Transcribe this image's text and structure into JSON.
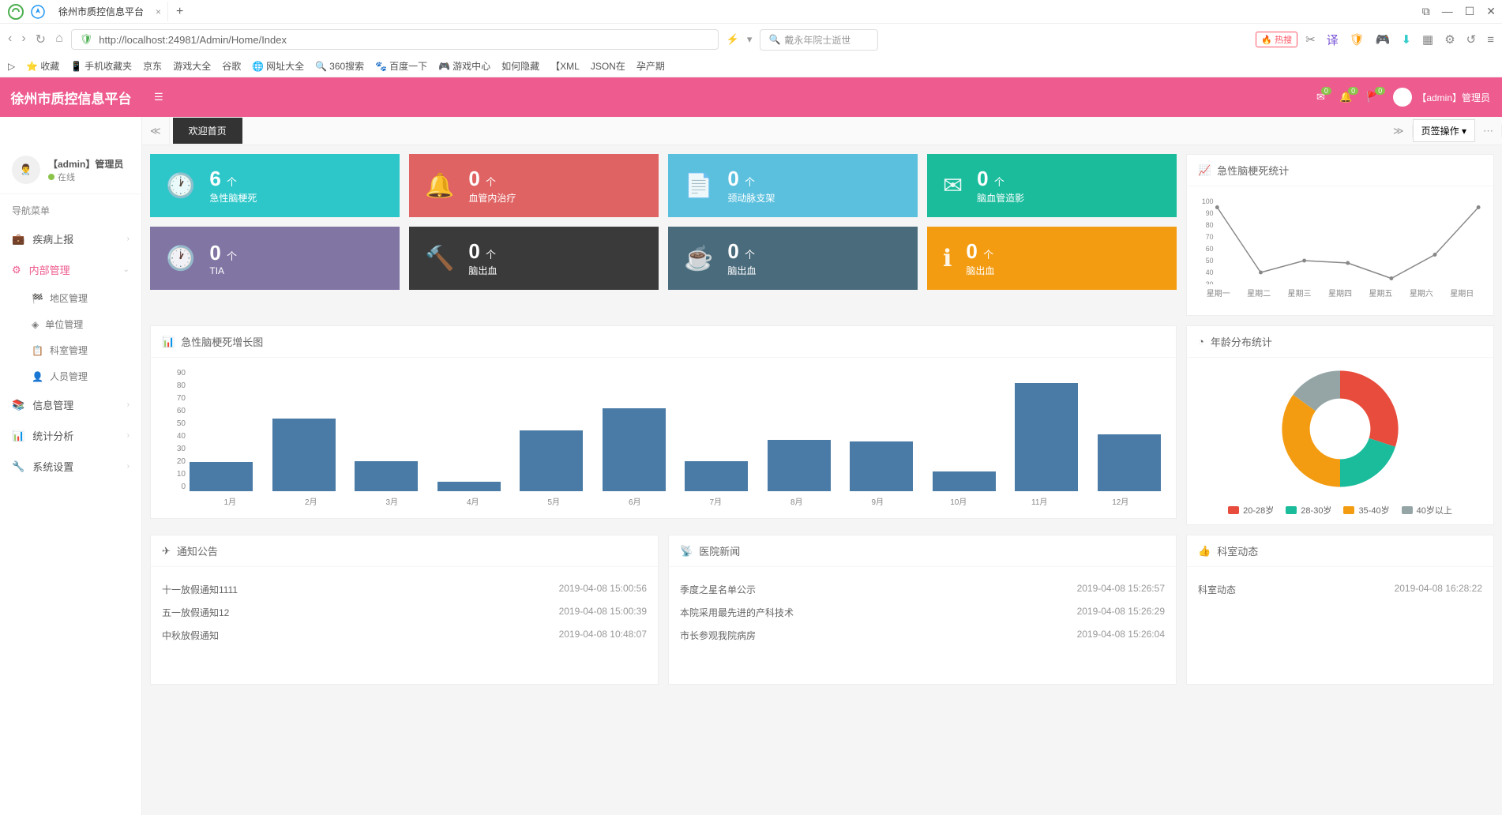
{
  "browser": {
    "tab_title": "徐州市质控信息平台",
    "url": "http://localhost:24981/Admin/Home/Index",
    "search_placeholder": "戴永年院士逝世",
    "hot_label": "热搜",
    "bookmarks": [
      "收藏",
      "手机收藏夹",
      "京东",
      "游戏大全",
      "谷歌",
      "网址大全",
      "360搜索",
      "百度一下",
      "游戏中心",
      "如何隐藏",
      "【XML",
      "JSON在",
      "孕产期"
    ]
  },
  "header": {
    "logo": "徐州市质控信息平台",
    "user": "【admin】管理员",
    "badge1": "0",
    "badge2": "0",
    "badge3": "0"
  },
  "tabs": {
    "home": "欢迎首页",
    "ops": "页签操作"
  },
  "sidebar": {
    "user_name": "【admin】管理员",
    "user_status": "在线",
    "nav_title": "导航菜单",
    "items": [
      {
        "icon": "📋",
        "label": "疾病上报"
      },
      {
        "icon": "⚙",
        "label": "内部管理",
        "active": true
      },
      {
        "icon": "ℹ",
        "label": "信息管理"
      },
      {
        "icon": "📊",
        "label": "统计分析"
      },
      {
        "icon": "🔧",
        "label": "系统设置"
      }
    ],
    "subitems": [
      {
        "icon": "🏁",
        "label": "地区管理"
      },
      {
        "icon": "◈",
        "label": "单位管理"
      },
      {
        "icon": "📄",
        "label": "科室管理"
      },
      {
        "icon": "👤",
        "label": "人员管理"
      }
    ]
  },
  "stats": {
    "row1": [
      {
        "num": "6",
        "unit": "个",
        "label": "急性脑梗死",
        "color": "c-teal",
        "icon": "clock"
      },
      {
        "num": "0",
        "unit": "个",
        "label": "血管内治疗",
        "color": "c-red",
        "icon": "bell"
      },
      {
        "num": "0",
        "unit": "个",
        "label": "颈动脉支架",
        "color": "c-blue",
        "icon": "file"
      },
      {
        "num": "0",
        "unit": "个",
        "label": "脑血管造影",
        "color": "c-green",
        "icon": "mail"
      }
    ],
    "row2": [
      {
        "num": "0",
        "unit": "个",
        "label": "TIA",
        "color": "c-purple",
        "icon": "clock"
      },
      {
        "num": "0",
        "unit": "个",
        "label": "脑出血",
        "color": "c-dark",
        "icon": "gavel"
      },
      {
        "num": "0",
        "unit": "个",
        "label": "脑出血",
        "color": "c-slate",
        "icon": "cup"
      },
      {
        "num": "0",
        "unit": "个",
        "label": "脑出血",
        "color": "c-orange",
        "icon": "info"
      }
    ]
  },
  "panels": {
    "line_title": "急性脑梗死统计",
    "bar_title": "急性脑梗死增长图",
    "pie_title": "年龄分布统计",
    "notice_title": "通知公告",
    "news_title": "医院新闻",
    "dept_title": "科室动态"
  },
  "chart_data": [
    {
      "type": "line",
      "title": "急性脑梗死统计",
      "categories": [
        "星期一",
        "星期二",
        "星期三",
        "星期四",
        "星期五",
        "星期六",
        "星期日"
      ],
      "values": [
        95,
        40,
        50,
        48,
        35,
        55,
        95
      ],
      "ylim": [
        30,
        100
      ],
      "xlabel": "",
      "ylabel": ""
    },
    {
      "type": "bar",
      "title": "急性脑梗死增长图",
      "categories": [
        "1月",
        "2月",
        "3月",
        "4月",
        "5月",
        "6月",
        "7月",
        "8月",
        "9月",
        "10月",
        "11月",
        "12月"
      ],
      "values": [
        22,
        55,
        23,
        7,
        46,
        63,
        23,
        39,
        38,
        15,
        82,
        43
      ],
      "ylim": [
        0,
        90
      ],
      "xlabel": "",
      "ylabel": ""
    },
    {
      "type": "pie",
      "title": "年龄分布统计",
      "series": [
        {
          "name": "20-28岁",
          "value": 30,
          "color": "#e74c3c"
        },
        {
          "name": "28-30岁",
          "value": 20,
          "color": "#1abc9c"
        },
        {
          "name": "35-40岁",
          "value": 35,
          "color": "#f39c12"
        },
        {
          "name": "40岁以上",
          "value": 15,
          "color": "#95a5a6"
        }
      ]
    }
  ],
  "notices": [
    {
      "title": "十一放假通知1111",
      "time": "2019-04-08 15:00:56"
    },
    {
      "title": "五一放假通知12",
      "time": "2019-04-08 15:00:39"
    },
    {
      "title": "中秋放假通知",
      "time": "2019-04-08 10:48:07"
    }
  ],
  "news": [
    {
      "title": "季度之星名单公示",
      "time": "2019-04-08 15:26:57"
    },
    {
      "title": "本院采用最先进的产科技术",
      "time": "2019-04-08 15:26:29"
    },
    {
      "title": "市长参观我院病房",
      "time": "2019-04-08 15:26:04"
    }
  ],
  "dept": [
    {
      "title": "科室动态",
      "time": "2019-04-08 16:28:22"
    }
  ]
}
